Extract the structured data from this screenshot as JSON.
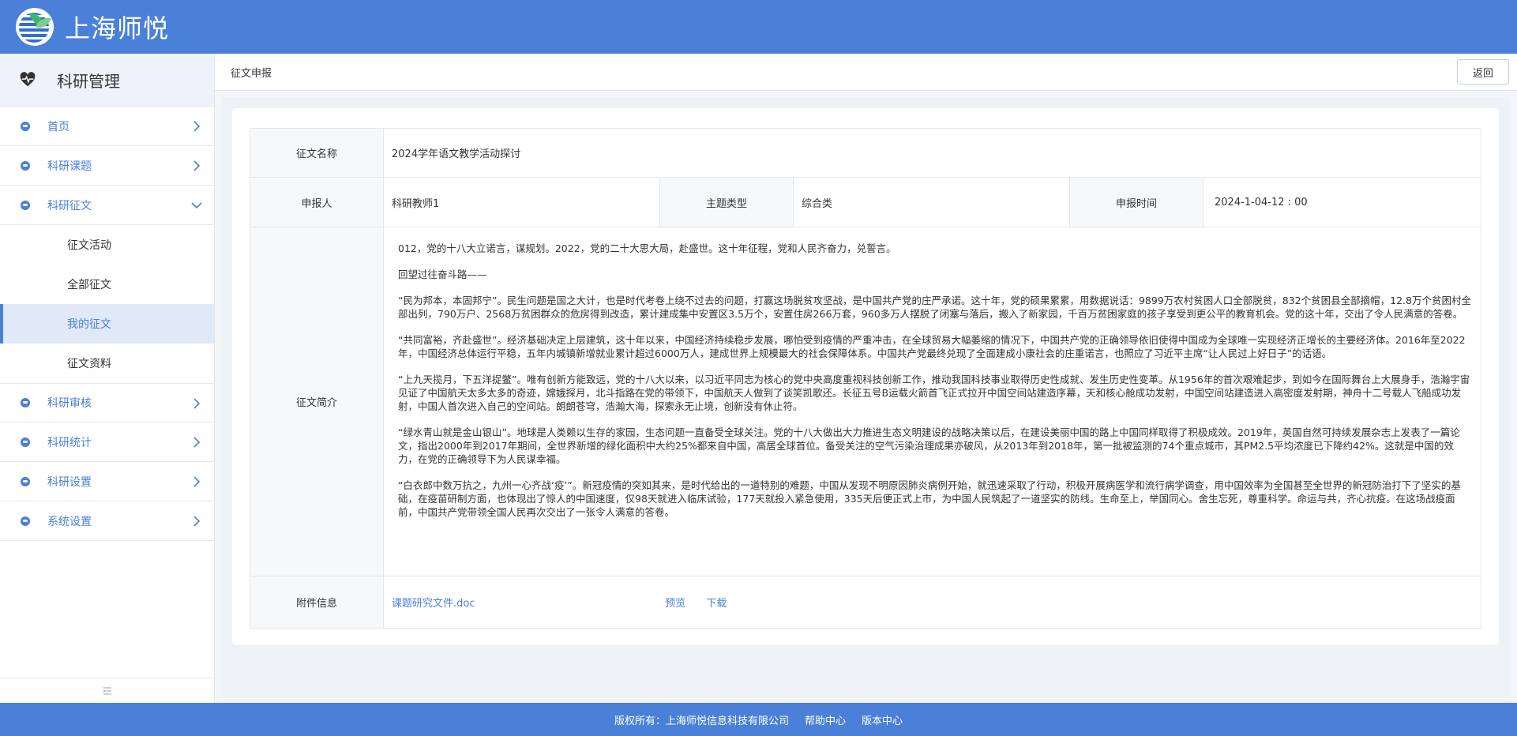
{
  "app": {
    "brand": "上海师悦"
  },
  "sidebar": {
    "title": "科研管理",
    "items": [
      {
        "label": "首页",
        "expanded": false
      },
      {
        "label": "科研课题",
        "expanded": false
      },
      {
        "label": "科研征文",
        "expanded": true
      },
      {
        "label": "科研审核",
        "expanded": false
      },
      {
        "label": "科研统计",
        "expanded": false
      },
      {
        "label": "科研设置",
        "expanded": false
      },
      {
        "label": "系统设置",
        "expanded": false
      }
    ],
    "subitems": [
      {
        "label": "征文活动",
        "active": false
      },
      {
        "label": "全部征文",
        "active": false
      },
      {
        "label": "我的征文",
        "active": true
      },
      {
        "label": "征文资料",
        "active": false
      }
    ]
  },
  "header": {
    "breadcrumb": "征文申报",
    "back_label": "返回"
  },
  "form": {
    "name_label": "征文名称",
    "name_value": "2024学年语文教学活动探讨",
    "applicant_label": "申报人",
    "applicant_value": "科研教师1",
    "theme_label": "主题类型",
    "theme_value": "综合类",
    "date_label": "申报时间",
    "date_value": "2024-1-04-12 : 00",
    "summary_label": "征文简介",
    "summary_paragraphs": [
      "012，党的十八大立诺言，谋规划。2022，党的二十大思大局，赴盛世。这十年征程，党和人民齐奋力，兑誓言。",
      "回望过往奋斗路——",
      "“民为邦本，本固邦宁”。民生问题是国之大计，也是时代考卷上绕不过去的问题，打赢这场脱贫攻坚战，是中国共产党的庄严承诺。这十年，党的硕果累累，用数据说话：9899万农村贫困人口全部脱贫，832个贫困县全部摘帽，12.8万个贫困村全部出列，790万户、2568万贫困群众的危房得到改造，累计建成集中安置区3.5万个，安置住房266万套，960多万人摆脱了闭塞与落后，搬入了新家园，千百万贫困家庭的孩子享受到更公平的教育机会。党的这十年，交出了令人民满意的答卷。",
      "“共同富裕，齐赴盛世”。经济基础决定上层建筑，这十年以来，中国经济持续稳步发展，哪怕受到疫情的严重冲击，在全球贸易大幅萎缩的情况下，中国共产党的正确领导依旧使得中国成为全球唯一实现经济正增长的主要经济体。2016年至2022年，中国经济总体运行平稳，五年内城镇新增就业累计超过6000万人，建成世界上规模最大的社会保障体系。中国共产党最终兑现了全面建成小康社会的庄重诺言，也照应了习近平主席“让人民过上好日子”的话语。",
      "“上九天揽月，下五洋捉鳖”。唯有创新方能致远，党的十八大以来，以习近平同志为核心的党中央高度重视科技创新工作，推动我国科技事业取得历史性成就、发生历史性变革。从1956年的首次艰难起步，到如今在国际舞台上大展身手，浩瀚宇宙见证了中国航天太多太多的奇迹，嫦娥探月，北斗指路在党的带领下，中国航天人做到了谈笑凯歌还。长征五号B运载火箭首飞正式拉开中国空间站建造序幕，天和核心舱成功发射，中国空间站建造进入高密度发射期，神舟十二号载人飞船成功发射，中国人首次进入自己的空间站。朗朗苍穹，浩瀚大海，探索永无止境，创新没有休止符。",
      "“绿水青山就是金山银山”。地球是人类赖以生存的家园，生态问题一直备受全球关注。党的十八大做出大力推进生态文明建设的战略决策以后，在建设美丽中国的路上中国同样取得了积极成效。2019年，英国自然可持续发展杂志上发表了一篇论文，指出2000年到2017年期间，全世界新增的绿化面积中大约25%都来自中国，高居全球首位。备受关注的空气污染治理成果亦破风，从2013年到2018年，第一批被监测的74个重点城市，其PM2.5平均浓度已下降约42%。这就是中国的效力，在党的正确领导下为人民谋幸福。",
      "“白衣郎中数万抗之，九州一心齐战‘疫’”。新冠疫情的突如其来，是时代给出的一道特别的难题，中国从发现不明原因肺炎病例开始，就迅速采取了行动，积极开展病医学和流行病学调查，用中国效率为全国甚至全世界的新冠防治打下了坚实的基础，在疫苗研制方面，也体现出了惊人的中国速度，仅98天就进入临床试验，177天就投入紧急使用，335天后便正式上市，为中国人民筑起了一道坚实的防线。生命至上，举国同心。舍生忘死，尊重科学。命运与共，齐心抗疫。在这场战疫面前，中国共产党带领全国人民再次交出了一张令人满意的答卷。"
    ],
    "attachment_label": "附件信息",
    "attachment_file": "课题研究文件.doc",
    "preview_label": "预览",
    "download_label": "下载"
  },
  "footer": {
    "copyright": "版权所有：上海师悦信息科技有限公司",
    "help": "帮助中心",
    "version": "版本中心"
  },
  "colors": {
    "primary": "#4a80d8",
    "active_bg": "#dfe9f8"
  }
}
